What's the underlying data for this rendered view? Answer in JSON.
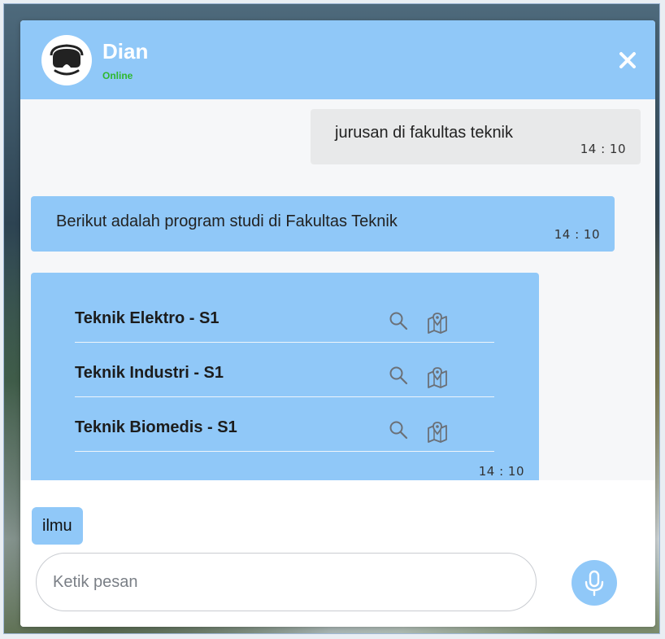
{
  "header": {
    "name": "Dian",
    "status": "Online",
    "avatar_icon": "vr-headset-icon",
    "close_icon": "close-icon"
  },
  "messages": {
    "user_1": {
      "text": "jurusan di fakultas teknik",
      "time": "14 : 10"
    },
    "bot_1": {
      "text": "Berikut adalah program studi di Fakultas Teknik",
      "time": "14 : 10"
    },
    "bot_2": {
      "items": [
        {
          "label": "Teknik Elektro - S1"
        },
        {
          "label": "Teknik Industri - S1"
        },
        {
          "label": "Teknik Biomedis - S1"
        }
      ],
      "time": "14 : 10"
    }
  },
  "suggestion": {
    "label": "ilmu"
  },
  "composer": {
    "placeholder": "Ketik pesan",
    "mic_icon": "microphone-icon"
  },
  "colors": {
    "accent": "#90c8f8",
    "user_bubble": "#e8e9ea",
    "online": "#2eb82e"
  }
}
